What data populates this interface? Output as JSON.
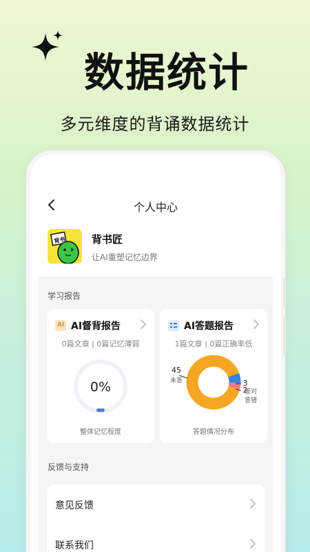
{
  "hero": {
    "title": "数据统计",
    "subtitle": "多元维度的背诵数据统计"
  },
  "header": {
    "title": "个人中心"
  },
  "profile": {
    "app_name": "背书匠",
    "slogan": "让AI重塑记忆边界",
    "avatar_text": "背书"
  },
  "study_report": {
    "section_label": "学习报告",
    "supervision": {
      "title": "AI督背报告",
      "summary": "0篇文章 | 0篇记忆薄弱",
      "progress_percent": 0,
      "progress_label": "0%",
      "caption": "整体记忆程度",
      "accent_color": "#f0a64a"
    },
    "answer": {
      "title": "AI答题报告",
      "summary": "1篇文章 | 0篇正确率低",
      "caption": "答题情况分布",
      "accent_color": "#3a7bd5",
      "segments": [
        {
          "label": "未答",
          "value": 45,
          "color": "#f5a623"
        },
        {
          "label": "答对",
          "value": 3,
          "color": "#3f7fdc"
        },
        {
          "label": "答错",
          "value": 2,
          "color": "#f27a7a"
        }
      ]
    }
  },
  "support": {
    "section_label": "反馈与支持",
    "items": [
      {
        "label": "意见反馈"
      },
      {
        "label": "联系我们"
      }
    ]
  }
}
